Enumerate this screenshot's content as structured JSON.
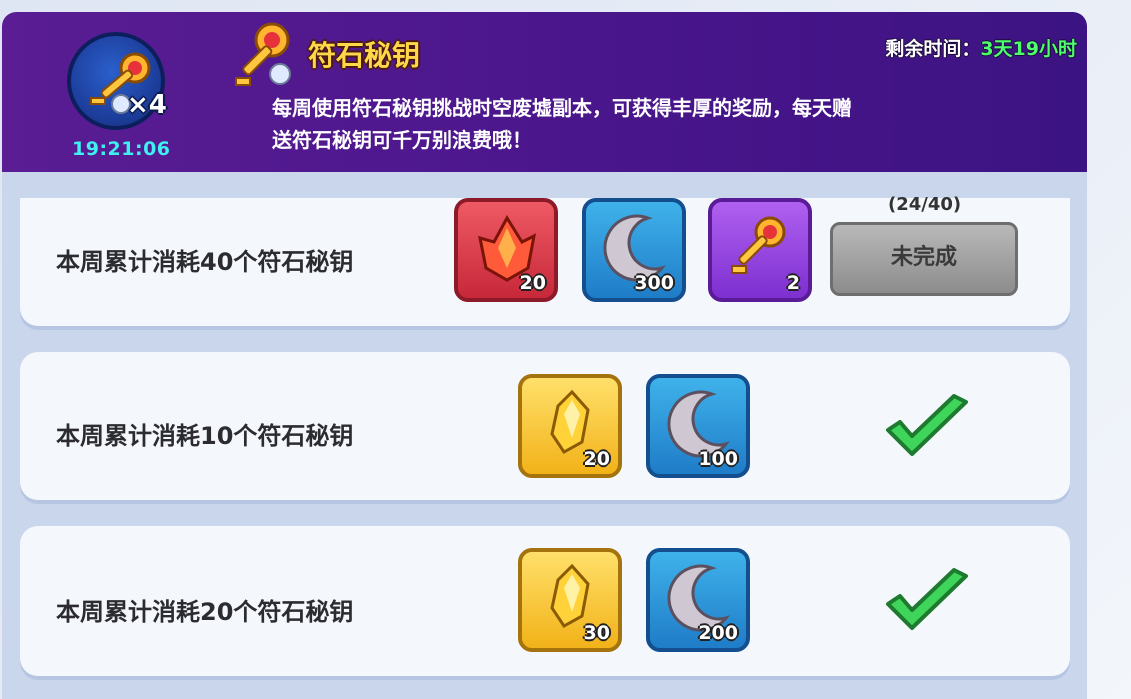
{
  "header": {
    "key_count": "×4",
    "timer": "19:21:06",
    "title": "符石秘钥",
    "remaining_label": "剩余时间：",
    "remaining_value": "3天19小时",
    "description_line1": "每周使用符石秘钥挑战时空废墟副本，可获得丰厚的奖励，每天赠",
    "description_line2": "送符石秘钥可千万别浪费哦！"
  },
  "quests": [
    {
      "label": "本周累计消耗40个符石秘钥",
      "progress": "(24/40)",
      "status": "未完成",
      "rewards": [
        {
          "icon": "red-crystal-icon",
          "qty": "20"
        },
        {
          "icon": "moon-stone-icon",
          "qty": "300"
        },
        {
          "icon": "rune-key-icon",
          "qty": "2"
        }
      ]
    },
    {
      "label": "本周累计消耗10个符石秘钥",
      "status": "completed",
      "rewards": [
        {
          "icon": "gold-crystal-icon",
          "qty": "20"
        },
        {
          "icon": "moon-stone-icon",
          "qty": "100"
        }
      ]
    },
    {
      "label": "本周累计消耗20个符石秘钥",
      "status": "completed",
      "rewards": [
        {
          "icon": "gold-crystal-icon",
          "qty": "30"
        },
        {
          "icon": "moon-stone-icon",
          "qty": "200"
        }
      ]
    }
  ],
  "colors": {
    "header_purple": "#4b168c",
    "title_gold": "#ffd84a",
    "timer_cyan": "#3ef0f0",
    "remaining_green": "#4dff6a",
    "check_green": "#3fd45a"
  }
}
